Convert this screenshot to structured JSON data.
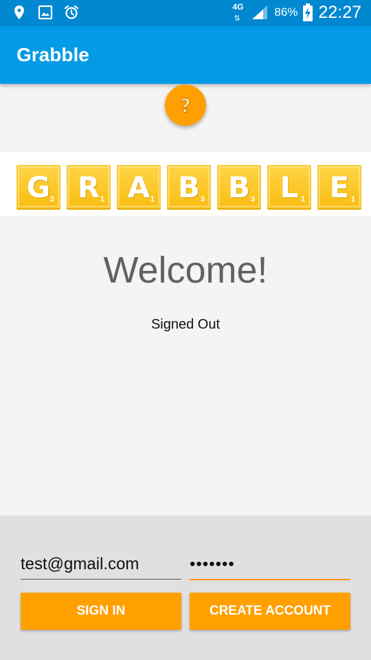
{
  "status_bar": {
    "network_type": "4G",
    "battery_percent": "86%",
    "time": "22:27",
    "icons": [
      "location-icon",
      "gallery-icon",
      "alarm-icon",
      "signal-icon",
      "battery-charging-icon"
    ]
  },
  "app_bar": {
    "title": "Grabble"
  },
  "help_button": {
    "icon": "question-icon"
  },
  "logo": {
    "tiles": [
      {
        "letter": "G",
        "points": "2"
      },
      {
        "letter": "R",
        "points": "1"
      },
      {
        "letter": "A",
        "points": "1"
      },
      {
        "letter": "B",
        "points": "3"
      },
      {
        "letter": "B",
        "points": "3"
      },
      {
        "letter": "L",
        "points": "1"
      },
      {
        "letter": "E",
        "points": "1"
      }
    ]
  },
  "main": {
    "welcome": "Welcome!",
    "status": "Signed Out"
  },
  "login": {
    "email_value": "test@gmail.com",
    "password_value": "•••••••",
    "sign_in_label": "SIGN IN",
    "create_account_label": "CREATE ACCOUNT"
  },
  "colors": {
    "status_bar": "#0288d1",
    "app_bar": "#039be5",
    "accent": "#ffa000",
    "tile": "#f9be12"
  }
}
